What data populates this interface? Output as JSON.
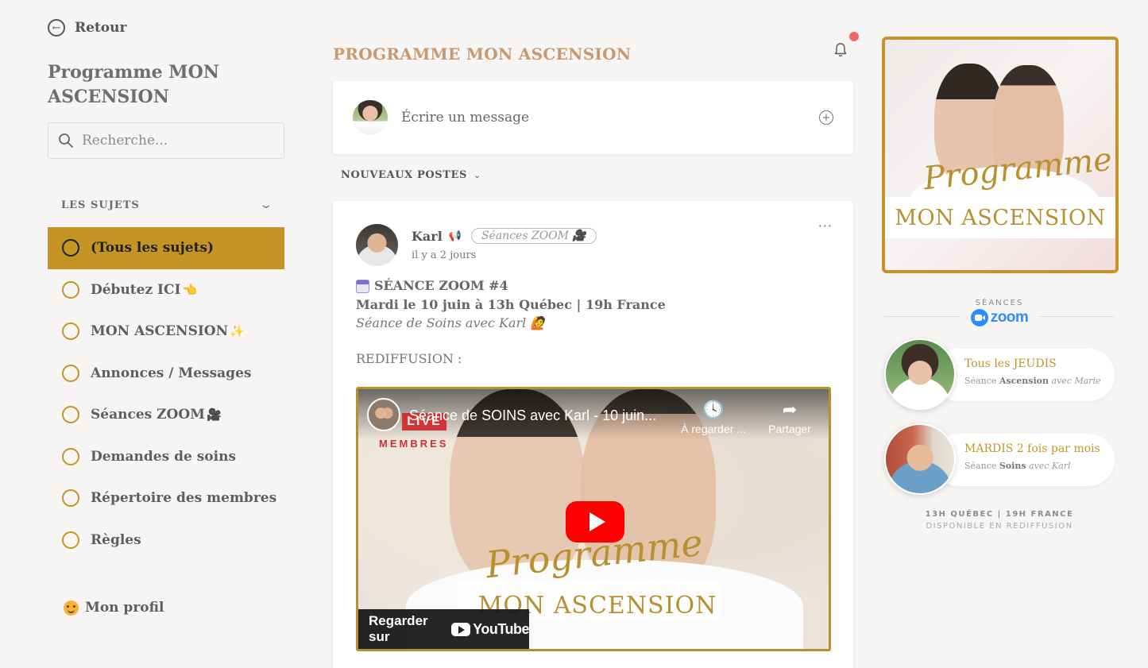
{
  "sidebar": {
    "back_label": "Retour",
    "program_title": "Programme MON ASCENSION",
    "search_placeholder": "Recherche...",
    "topics_label": "LES SUJETS",
    "topics": [
      {
        "label": "(Tous les sujets)",
        "emoji": "",
        "active": true
      },
      {
        "label": "Débutez ICI",
        "emoji": "👈"
      },
      {
        "label": "MON ASCENSION",
        "emoji": "✨"
      },
      {
        "label": "Annonces / Messages",
        "emoji": ""
      },
      {
        "label": "Séances ZOOM",
        "emoji": "🎥"
      },
      {
        "label": "Demandes de soins",
        "emoji": ""
      },
      {
        "label": "Répertoire des membres",
        "emoji": ""
      },
      {
        "label": "Règles",
        "emoji": ""
      }
    ],
    "profile_label": "Mon profil"
  },
  "main": {
    "title": "PROGRAMME MON ASCENSION",
    "compose_placeholder": "Écrire un message",
    "sort_label": "NOUVEAUX POSTES",
    "post": {
      "author": "Karl",
      "tag": "Séances ZOOM 🎥",
      "time": "il y a 2 jours",
      "line1": "SÉANCE ZOOM #4",
      "line2": "Mardi le 10 juin à 13h Québec | 19h France",
      "line3": "Séance de Soins avec Karl 🙋",
      "line4": "REDIFFUSION :",
      "video": {
        "title": "Séance de SOINS avec Karl - 10 juin...",
        "live_label": "LIVE",
        "members_label": "MEMBRES",
        "watch_later": "À regarder ...",
        "share": "Partager",
        "script_text": "Programme",
        "brand_text": "MON ASCENSION",
        "watch_on": "Regarder sur",
        "youtube": "YouTube"
      }
    }
  },
  "right": {
    "banner": {
      "script_text": "Programme",
      "brand_text": "MON ASCENSION"
    },
    "seances_label": "SÉANCES",
    "zoom_label": "zoom",
    "sessions": [
      {
        "title": "Tous les JEUDIS",
        "sub_prefix": "Séance",
        "sub_bold": "Ascension",
        "sub_italic": "avec Marie"
      },
      {
        "title": "MARDIS 2 fois par mois",
        "sub_prefix": "Séance",
        "sub_bold": "Soins",
        "sub_italic": "avec Karl"
      }
    ],
    "footnote_line1": "13H QUÉBEC  |  19H FRANCE",
    "footnote_line2": "DISPONIBLE EN REDIFFUSION"
  },
  "colors": {
    "accent_gold": "#c49526",
    "title_tan": "#c9986e",
    "notification_dot": "#ee6a6a",
    "zoom_blue": "#2d8cff",
    "youtube_red": "#ff0000"
  }
}
